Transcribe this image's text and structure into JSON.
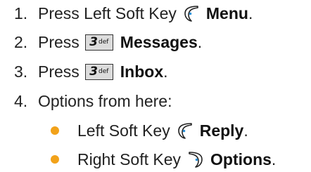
{
  "steps": [
    {
      "num": "1.",
      "prefix": "Press Left Soft Key",
      "icon": "left-soft-key-icon",
      "action": "Menu",
      "end": "."
    },
    {
      "num": "2.",
      "prefix": "Press",
      "key": {
        "digit": "3",
        "letters": "def"
      },
      "action": "Messages",
      "end": "."
    },
    {
      "num": "3.",
      "prefix": "Press",
      "key": {
        "digit": "3",
        "letters": "def"
      },
      "action": "Inbox",
      "end": "."
    },
    {
      "num": "4.",
      "text": "Options from here:"
    }
  ],
  "bullets": [
    {
      "prefix": "Left Soft Key",
      "icon": "left-soft-key-icon",
      "action": "Reply",
      "end": "."
    },
    {
      "prefix": "Right Soft Key",
      "icon": "right-soft-key-icon",
      "action": "Options",
      "end": "."
    }
  ],
  "colors": {
    "bullet": "#f2a21a",
    "key_fill": "#dcdcdc",
    "text": "#222222"
  }
}
